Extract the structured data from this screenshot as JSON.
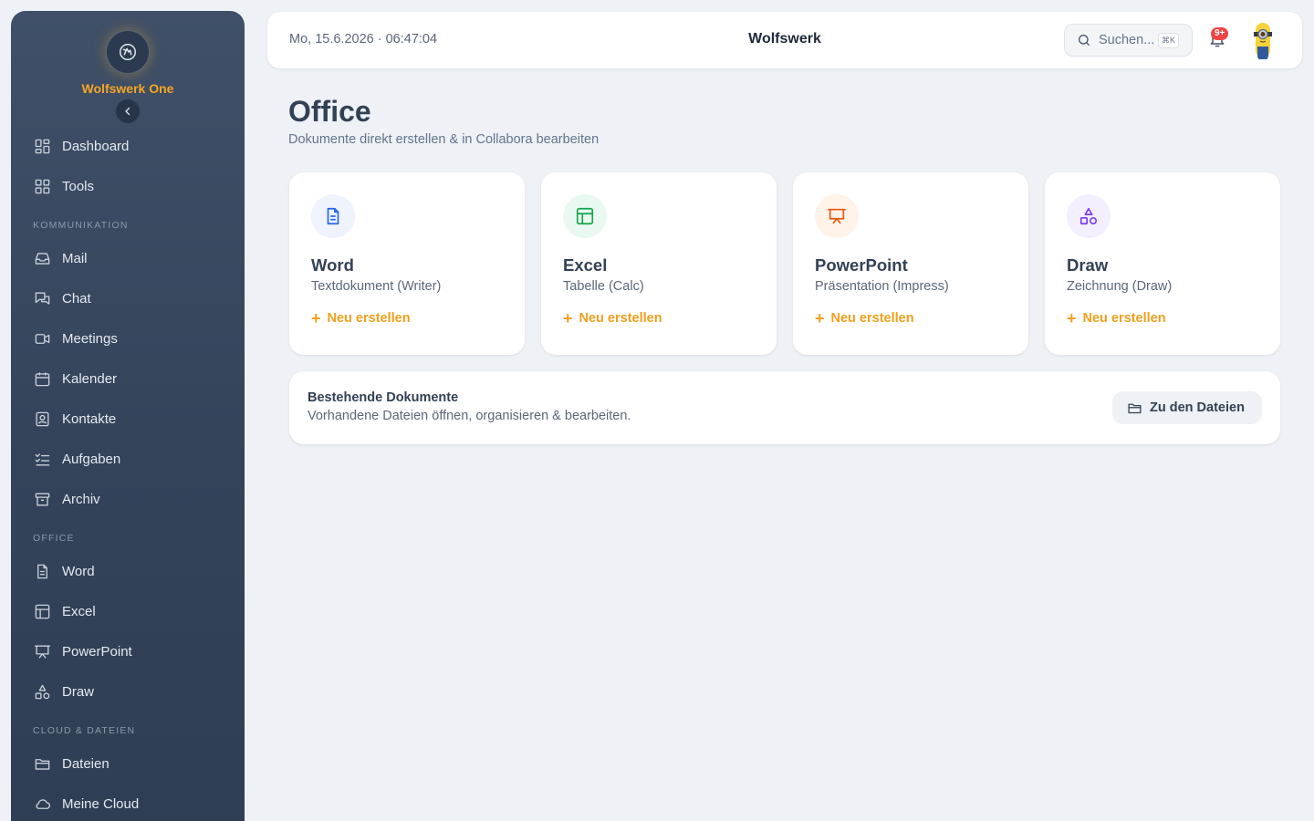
{
  "sidebar": {
    "brand_name": "Wolfswerk One",
    "items": [
      {
        "label": "Dashboard",
        "icon": "dashboard-icon"
      },
      {
        "label": "Tools",
        "icon": "grid-icon"
      },
      {
        "label": "Mail",
        "icon": "inbox-icon"
      },
      {
        "label": "Chat",
        "icon": "chat-icon"
      },
      {
        "label": "Meetings",
        "icon": "video-icon"
      },
      {
        "label": "Kalender",
        "icon": "calendar-icon"
      },
      {
        "label": "Kontakte",
        "icon": "contact-icon"
      },
      {
        "label": "Aufgaben",
        "icon": "tasks-icon"
      },
      {
        "label": "Archiv",
        "icon": "archive-icon"
      },
      {
        "label": "Word",
        "icon": "document-icon"
      },
      {
        "label": "Excel",
        "icon": "table-icon"
      },
      {
        "label": "PowerPoint",
        "icon": "presentation-icon"
      },
      {
        "label": "Draw",
        "icon": "shapes-icon"
      },
      {
        "label": "Dateien",
        "icon": "folder-icon"
      },
      {
        "label": "Meine Cloud",
        "icon": "cloud-icon"
      }
    ],
    "sections": [
      "Kommunikation",
      "Office",
      "Cloud & Dateien"
    ]
  },
  "header": {
    "datetime": "Mo, 15.6.2026 · 06:47:04",
    "title": "Wolfswerk",
    "search_placeholder": "Suchen...",
    "search_shortcut": "⌘K",
    "notification_badge": "9+"
  },
  "main": {
    "title": "Office",
    "subtitle": "Dokumente direkt erstellen & in Collabora bearbeiten",
    "cards": [
      {
        "title": "Word",
        "subtitle": "Textdokument (Writer)",
        "action": "Neu erstellen",
        "icon": "document-icon",
        "color": "#2563eb",
        "bg": "#eef3fe"
      },
      {
        "title": "Excel",
        "subtitle": "Tabelle (Calc)",
        "action": "Neu erstellen",
        "icon": "table-icon",
        "color": "#16a34a",
        "bg": "#e9f8f0"
      },
      {
        "title": "PowerPoint",
        "subtitle": "Präsentation (Impress)",
        "action": "Neu erstellen",
        "icon": "presentation-icon",
        "color": "#ea580c",
        "bg": "#fff2e9"
      },
      {
        "title": "Draw",
        "subtitle": "Zeichnung (Draw)",
        "action": "Neu erstellen",
        "icon": "shapes-icon",
        "color": "#7c3aed",
        "bg": "#f3effe"
      }
    ],
    "existing": {
      "title": "Bestehende Dokumente",
      "subtitle": "Vorhandene Dateien öffnen, organisieren & bearbeiten.",
      "button": "Zu den Dateien"
    }
  },
  "colors": {
    "accent": "#f5a623",
    "sidebar": "#36465c",
    "background": "#eef1f6"
  }
}
